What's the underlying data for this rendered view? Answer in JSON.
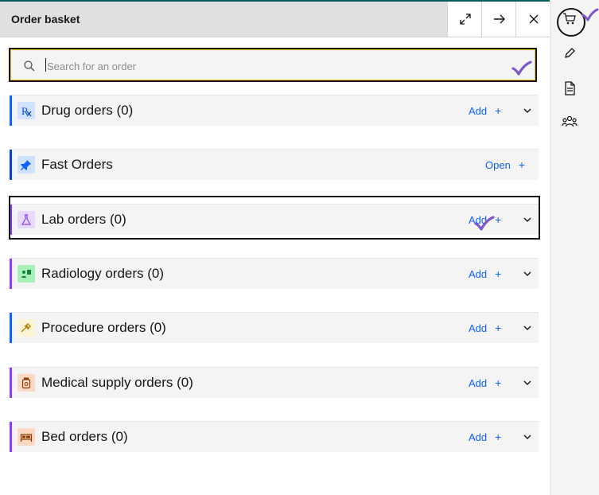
{
  "header": {
    "title": "Order basket",
    "maximize_icon": "maximize-icon",
    "arrow_icon": "arrow-right-icon",
    "close_icon": "close-icon"
  },
  "search": {
    "placeholder": "Search for an order",
    "value": ""
  },
  "rows": [
    {
      "label": "Drug orders (0)",
      "action": "Add",
      "icon": "prescription-icon",
      "accent": "#0f62fe",
      "icon_bg": "#d0e2ff"
    },
    {
      "label": "Fast Orders",
      "action": "Open",
      "icon": "pin-icon",
      "accent": "#0043ce",
      "icon_bg": "#d0e2ff"
    },
    {
      "label": "Lab orders (0)",
      "action": "Add",
      "icon": "flask-icon",
      "accent": "#8a3ffc",
      "icon_bg": "#e8daff"
    },
    {
      "label": "Radiology orders (0)",
      "action": "Add",
      "icon": "radiology-icon",
      "accent": "#8a3ffc",
      "icon_bg": "#a7f0ba"
    },
    {
      "label": "Procedure orders (0)",
      "action": "Add",
      "icon": "procedure-icon",
      "accent": "#0f62fe",
      "icon_bg": "#fcf4d6"
    },
    {
      "label": "Medical supply orders (0)",
      "action": "Add",
      "icon": "supply-jar-icon",
      "accent": "#8a3ffc",
      "icon_bg": "#fcd9c4"
    },
    {
      "label": "Bed orders (0)",
      "action": "Add",
      "icon": "bed-icon",
      "accent": "#8a3ffc",
      "icon_bg": "#fcd9c4"
    }
  ],
  "rail": [
    {
      "icon": "shopping-cart-icon",
      "selected": true
    },
    {
      "icon": "pen-icon"
    },
    {
      "icon": "document-icon"
    },
    {
      "icon": "user-group-icon"
    }
  ],
  "colors": {
    "link": "#0f62fe",
    "check": "#7f58c8"
  }
}
